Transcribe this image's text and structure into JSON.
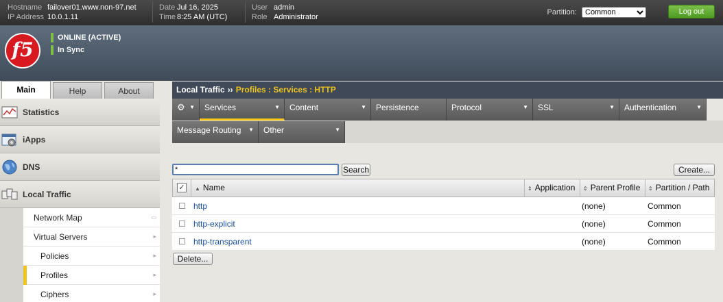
{
  "topbar": {
    "hostname_label": "Hostname",
    "hostname": "failover01.www.non-97.net",
    "ip_label": "IP Address",
    "ip": "10.0.1.11",
    "date_label": "Date",
    "date": "Jul 16, 2025",
    "time_label": "Time",
    "time": "8:25 AM (UTC)",
    "user_label": "User",
    "user": "admin",
    "role_label": "Role",
    "role": "Administrator",
    "partition_label": "Partition:",
    "partition_value": "Common",
    "logout_label": "Log out"
  },
  "header": {
    "logo_text": "f5",
    "status": "ONLINE (ACTIVE)",
    "sync": "In Sync",
    "status_color": "#7cc04a"
  },
  "left_tabs": [
    {
      "label": "Main",
      "active": true
    },
    {
      "label": "Help",
      "active": false
    },
    {
      "label": "About",
      "active": false
    }
  ],
  "sidebar": {
    "sections": [
      {
        "label": "Statistics",
        "icon": "statistics-icon"
      },
      {
        "label": "iApps",
        "icon": "iapps-icon"
      },
      {
        "label": "DNS",
        "icon": "dns-globe-icon"
      },
      {
        "label": "Local Traffic",
        "icon": "local-traffic-icon"
      }
    ],
    "sub_items": [
      {
        "label": "Network Map"
      },
      {
        "label": "Virtual Servers"
      },
      {
        "label": "Policies"
      },
      {
        "label": "Profiles",
        "active": true
      },
      {
        "label": "Ciphers"
      }
    ]
  },
  "breadcrumb": {
    "root": "Local Traffic",
    "separator": "››",
    "path": "Profiles : Services : HTTP"
  },
  "menu": {
    "items": [
      {
        "label": "Services",
        "active": true
      },
      {
        "label": "Content"
      },
      {
        "label": "Persistence"
      },
      {
        "label": "Protocol"
      },
      {
        "label": "SSL"
      },
      {
        "label": "Authentication"
      },
      {
        "label": "Message Routing"
      },
      {
        "label": "Other"
      }
    ]
  },
  "search": {
    "value": "*",
    "button_label": "Search"
  },
  "create_label": "Create...",
  "delete_label": "Delete...",
  "table": {
    "headers": [
      "Name",
      "Application",
      "Parent Profile",
      "Partition / Path"
    ],
    "rows": [
      {
        "name": "http",
        "application": "",
        "parent": "(none)",
        "partition": "Common"
      },
      {
        "name": "http-explicit",
        "application": "",
        "parent": "(none)",
        "partition": "Common"
      },
      {
        "name": "http-transparent",
        "application": "",
        "parent": "(none)",
        "partition": "Common"
      }
    ]
  },
  "colors": {
    "accent": "#f0c419",
    "link": "#1a4fa0",
    "logout": "#5aa82c",
    "brand": "#d71920"
  }
}
